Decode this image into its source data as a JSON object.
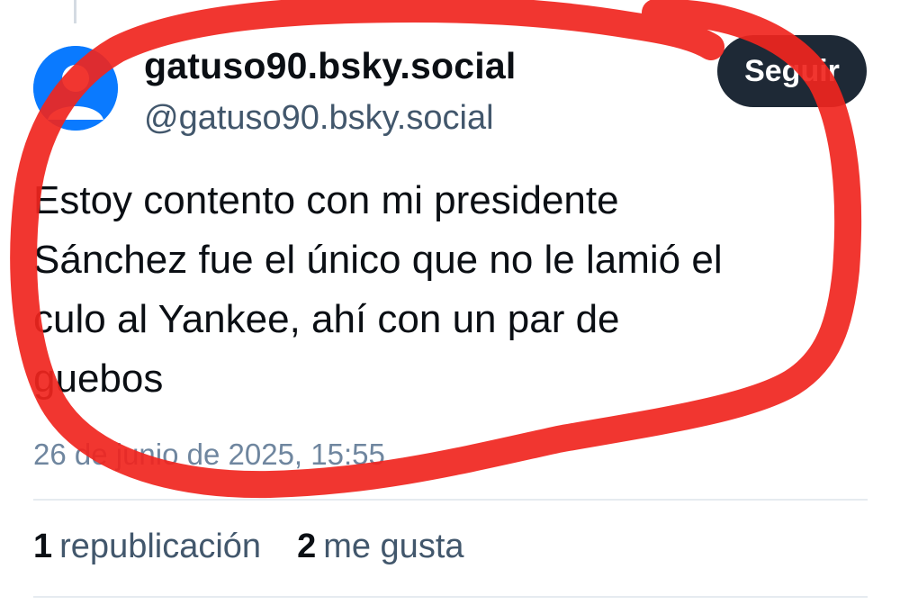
{
  "post": {
    "author": {
      "display_name": "gatuso90.bsky.social",
      "handle": "@gatuso90.bsky.social",
      "avatar_icon": "default-user-avatar-icon",
      "avatar_color": "#0a7aff"
    },
    "follow_label": "Seguir",
    "text": "Estoy contento con mi presidente\nSánchez fue el único que no le lamió el\nculo al Yankee, ahí con un par de\nguebos",
    "timestamp": "26 de junio de 2025, 15:55",
    "stats": {
      "reposts_count": "1",
      "reposts_label": "republicación",
      "likes_count": "2",
      "likes_label": "me gusta"
    }
  },
  "annotation": {
    "color": "#f0251e",
    "shape": "hand-drawn red circle around post"
  }
}
